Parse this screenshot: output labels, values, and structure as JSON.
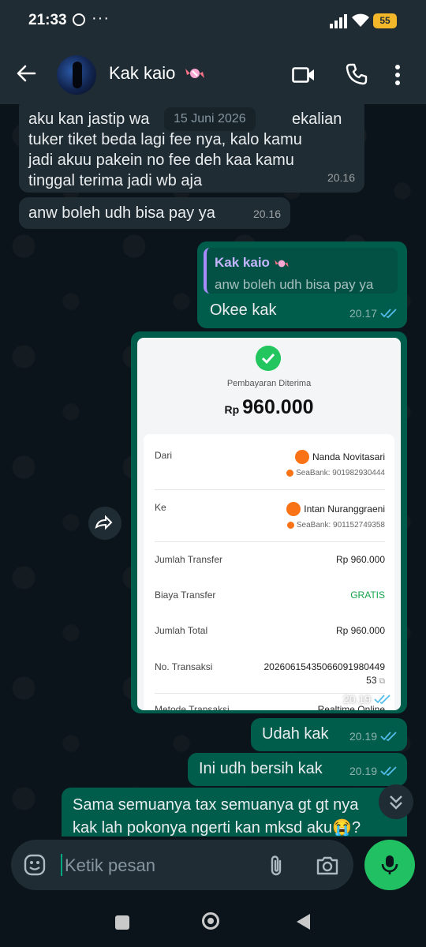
{
  "status": {
    "time": "21:33",
    "more": "···",
    "battery": "55"
  },
  "header": {
    "contact_name": "Kak kaio"
  },
  "date_chip": "15 Juni 2026",
  "messages": [
    {
      "text": "aku kan jastip wa... sekalian tuker tiket beda lagi fee nya, kalo kamu jadi akuu pakein no fee deh kaa kamu tinggal terima jadi wb aja",
      "time": "20.16"
    },
    {
      "text": "anw boleh udh bisa pay ya",
      "time": "20.16"
    },
    {
      "quote_name": "Kak kaio",
      "quote_text": "anw boleh udh bisa pay ya",
      "text": "Okee kak",
      "time": "20.17"
    },
    {
      "time": "20.19"
    },
    {
      "text": "Udah kak",
      "time": "20.19"
    },
    {
      "text": "Ini udh bersih kak",
      "time": "20.19"
    },
    {
      "text": "Sama semuanya tax semuanya gt gt nya kak lah pokonya ngerti kan mksd aku😭?"
    }
  ],
  "msg0_lines": [
    "aku kan jastip wa",
    "ekalian",
    "tuker tiket beda lagi fee nya, kalo kamu",
    "jadi akuu pakein no fee deh kaa kamu",
    "tinggal terima jadi wb aja"
  ],
  "msg6_lines": [
    "Sama semuanya tax semuanya gt gt nya",
    "kak lah pokonya ngerti kan mksd aku😭?"
  ],
  "receipt": {
    "title": "Pembayaran Diterima",
    "currency": "Rp",
    "amount": "960.000",
    "from_label": "Dari",
    "from_name": "Nanda Novitasari",
    "from_bank": "SeaBank: 901982930444",
    "to_label": "Ke",
    "to_name": "Intan Nuranggraeni",
    "to_bank": "SeaBank: 901152749358",
    "transfer_label": "Jumlah Transfer",
    "transfer_value": "Rp 960.000",
    "fee_label": "Biaya Transfer",
    "fee_value": "GRATIS",
    "total_label": "Jumlah Total",
    "total_value": "Rp 960.000",
    "trx_label": "No. Transaksi",
    "trx_value_1": "20260615435066091980449",
    "trx_value_2": "53",
    "method_label": "Metode Transaksi",
    "method_value": "Realtime Online"
  },
  "composer": {
    "placeholder": "Ketik pesan"
  },
  "colors": {
    "accent": "#00a884",
    "outgoing": "#005c4b",
    "incoming": "#202c33",
    "mic": "#21c063",
    "gratis": "#16a34a"
  },
  "icons": [
    "back-arrow-icon",
    "candy-icon",
    "video-call-icon",
    "phone-icon",
    "more-vert-icon",
    "forward-icon",
    "double-check-icon",
    "chevrons-down-icon",
    "emoji-icon",
    "attach-icon",
    "camera-icon",
    "mic-icon"
  ]
}
